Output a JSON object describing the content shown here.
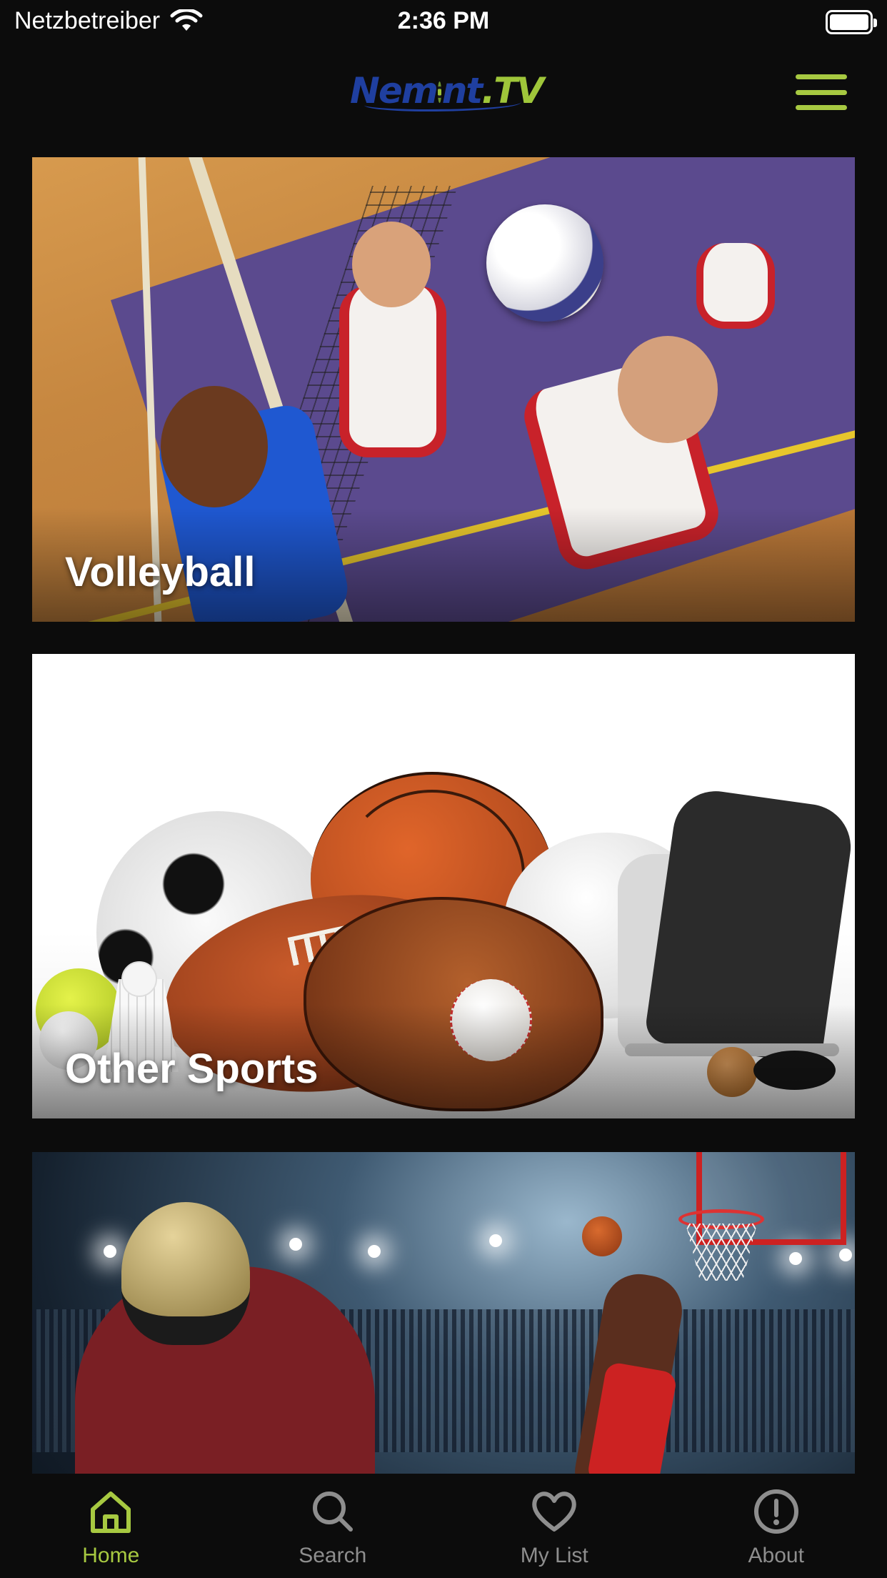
{
  "status_bar": {
    "carrier": "Netzbetreiber",
    "time": "2:36 PM"
  },
  "header": {
    "logo_text_main": "Nem",
    "logo_text_mid": "nt",
    "logo_text_tv": ".TV",
    "menu_icon": "hamburger-menu-icon"
  },
  "categories": [
    {
      "title": "Volleyball"
    },
    {
      "title": "Other Sports"
    },
    {
      "title": ""
    }
  ],
  "tab_bar": {
    "items": [
      {
        "label": "Home",
        "icon": "home-icon",
        "active": true
      },
      {
        "label": "Search",
        "icon": "search-icon",
        "active": false
      },
      {
        "label": "My List",
        "icon": "heart-icon",
        "active": false
      },
      {
        "label": "About",
        "icon": "info-icon",
        "active": false
      }
    ]
  },
  "colors": {
    "accent": "#a7c941",
    "background": "#0c0c0c",
    "inactive_tab": "#8e8e8e"
  }
}
